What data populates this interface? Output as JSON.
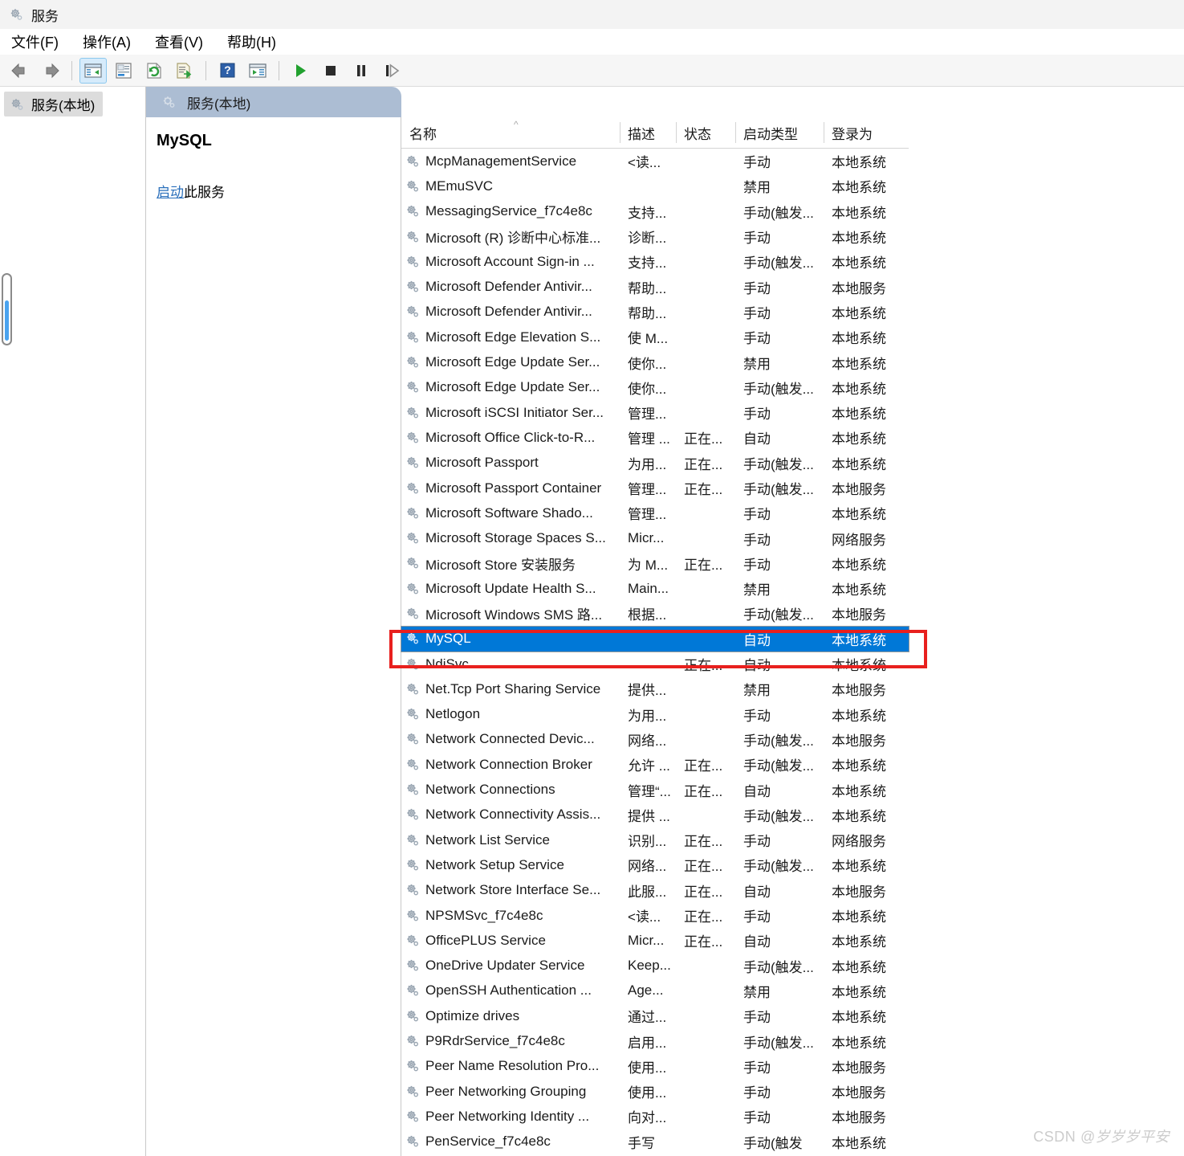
{
  "window": {
    "title": "服务",
    "title_icon": "gear-icon"
  },
  "menu": {
    "items": [
      {
        "label": "文件(F)",
        "name": "file"
      },
      {
        "label": "操作(A)",
        "name": "action"
      },
      {
        "label": "查看(V)",
        "name": "view"
      },
      {
        "label": "帮助(H)",
        "name": "help"
      }
    ]
  },
  "toolbar": {
    "buttons": [
      {
        "name": "back-icon",
        "glyph": "back"
      },
      {
        "name": "forward-icon",
        "glyph": "forward"
      },
      {
        "name": "show-hide-tree-icon",
        "glyph": "tree"
      },
      {
        "name": "properties-icon",
        "glyph": "properties"
      },
      {
        "name": "refresh-icon",
        "glyph": "refresh"
      },
      {
        "name": "export-list-icon",
        "glyph": "export"
      },
      {
        "name": "help-icon",
        "glyph": "help"
      },
      {
        "name": "show-action-pane-icon",
        "glyph": "actionpane"
      },
      {
        "name": "start-service-icon",
        "glyph": "play"
      },
      {
        "name": "stop-service-icon",
        "glyph": "stop"
      },
      {
        "name": "pause-service-icon",
        "glyph": "pause"
      },
      {
        "name": "restart-service-icon",
        "glyph": "restart"
      }
    ]
  },
  "tree": {
    "items": [
      {
        "label": "服务(本地)",
        "icon": "gear-icon",
        "selected": true
      }
    ]
  },
  "panel": {
    "header": "服务(本地)",
    "header_icon": "gear-icon"
  },
  "detail": {
    "service_name": "MySQL",
    "action_link": "启动",
    "action_suffix": "此服务"
  },
  "grid": {
    "sort_indicator": "^",
    "sort_column": "名称",
    "columns": [
      {
        "key": "name",
        "label": "名称"
      },
      {
        "key": "desc",
        "label": "描述"
      },
      {
        "key": "status",
        "label": "状态"
      },
      {
        "key": "start",
        "label": "启动类型"
      },
      {
        "key": "logon",
        "label": "登录为"
      }
    ],
    "rows": [
      {
        "name": "McpManagementService",
        "desc": "<读...",
        "status": "",
        "start": "手动",
        "logon": "本地系统",
        "selected": false
      },
      {
        "name": "MEmuSVC",
        "desc": "",
        "status": "",
        "start": "禁用",
        "logon": "本地系统",
        "selected": false
      },
      {
        "name": "MessagingService_f7c4e8c",
        "desc": "支持...",
        "status": "",
        "start": "手动(触发...",
        "logon": "本地系统",
        "selected": false
      },
      {
        "name": "Microsoft (R) 诊断中心标准...",
        "desc": "诊断...",
        "status": "",
        "start": "手动",
        "logon": "本地系统",
        "selected": false
      },
      {
        "name": "Microsoft Account Sign-in ...",
        "desc": "支持...",
        "status": "",
        "start": "手动(触发...",
        "logon": "本地系统",
        "selected": false
      },
      {
        "name": "Microsoft Defender Antivir...",
        "desc": "帮助...",
        "status": "",
        "start": "手动",
        "logon": "本地服务",
        "selected": false
      },
      {
        "name": "Microsoft Defender Antivir...",
        "desc": "帮助...",
        "status": "",
        "start": "手动",
        "logon": "本地系统",
        "selected": false
      },
      {
        "name": "Microsoft Edge Elevation S...",
        "desc": "使 M...",
        "status": "",
        "start": "手动",
        "logon": "本地系统",
        "selected": false
      },
      {
        "name": "Microsoft Edge Update Ser...",
        "desc": "使你...",
        "status": "",
        "start": "禁用",
        "logon": "本地系统",
        "selected": false
      },
      {
        "name": "Microsoft Edge Update Ser...",
        "desc": "使你...",
        "status": "",
        "start": "手动(触发...",
        "logon": "本地系统",
        "selected": false
      },
      {
        "name": "Microsoft iSCSI Initiator Ser...",
        "desc": "管理...",
        "status": "",
        "start": "手动",
        "logon": "本地系统",
        "selected": false
      },
      {
        "name": "Microsoft Office Click-to-R...",
        "desc": "管理 ...",
        "status": "正在...",
        "start": "自动",
        "logon": "本地系统",
        "selected": false
      },
      {
        "name": "Microsoft Passport",
        "desc": "为用...",
        "status": "正在...",
        "start": "手动(触发...",
        "logon": "本地系统",
        "selected": false
      },
      {
        "name": "Microsoft Passport Container",
        "desc": "管理...",
        "status": "正在...",
        "start": "手动(触发...",
        "logon": "本地服务",
        "selected": false
      },
      {
        "name": "Microsoft Software Shado...",
        "desc": "管理...",
        "status": "",
        "start": "手动",
        "logon": "本地系统",
        "selected": false
      },
      {
        "name": "Microsoft Storage Spaces S...",
        "desc": "Micr...",
        "status": "",
        "start": "手动",
        "logon": "网络服务",
        "selected": false
      },
      {
        "name": "Microsoft Store 安装服务",
        "desc": "为 M...",
        "status": "正在...",
        "start": "手动",
        "logon": "本地系统",
        "selected": false
      },
      {
        "name": "Microsoft Update Health S...",
        "desc": "Main...",
        "status": "",
        "start": "禁用",
        "logon": "本地系统",
        "selected": false
      },
      {
        "name": "Microsoft Windows SMS 路...",
        "desc": "根据...",
        "status": "",
        "start": "手动(触发...",
        "logon": "本地服务",
        "selected": false
      },
      {
        "name": "MySQL",
        "desc": "",
        "status": "",
        "start": "自动",
        "logon": "本地系统",
        "selected": true
      },
      {
        "name": "NdiSvc",
        "desc": "",
        "status": "正在...",
        "start": "自动",
        "logon": "本地系统",
        "selected": false
      },
      {
        "name": "Net.Tcp Port Sharing Service",
        "desc": "提供...",
        "status": "",
        "start": "禁用",
        "logon": "本地服务",
        "selected": false
      },
      {
        "name": "Netlogon",
        "desc": "为用...",
        "status": "",
        "start": "手动",
        "logon": "本地系统",
        "selected": false
      },
      {
        "name": "Network Connected Devic...",
        "desc": "网络...",
        "status": "",
        "start": "手动(触发...",
        "logon": "本地服务",
        "selected": false
      },
      {
        "name": "Network Connection Broker",
        "desc": "允许 ...",
        "status": "正在...",
        "start": "手动(触发...",
        "logon": "本地系统",
        "selected": false
      },
      {
        "name": "Network Connections",
        "desc": "管理“...",
        "status": "正在...",
        "start": "自动",
        "logon": "本地系统",
        "selected": false
      },
      {
        "name": "Network Connectivity Assis...",
        "desc": "提供 ...",
        "status": "",
        "start": "手动(触发...",
        "logon": "本地系统",
        "selected": false
      },
      {
        "name": "Network List Service",
        "desc": "识别...",
        "status": "正在...",
        "start": "手动",
        "logon": "网络服务",
        "selected": false
      },
      {
        "name": "Network Setup Service",
        "desc": "网络...",
        "status": "正在...",
        "start": "手动(触发...",
        "logon": "本地系统",
        "selected": false
      },
      {
        "name": "Network Store Interface Se...",
        "desc": "此服...",
        "status": "正在...",
        "start": "自动",
        "logon": "本地服务",
        "selected": false
      },
      {
        "name": "NPSMSvc_f7c4e8c",
        "desc": "<读...",
        "status": "正在...",
        "start": "手动",
        "logon": "本地系统",
        "selected": false
      },
      {
        "name": "OfficePLUS Service",
        "desc": "Micr...",
        "status": "正在...",
        "start": "自动",
        "logon": "本地系统",
        "selected": false
      },
      {
        "name": "OneDrive Updater Service",
        "desc": "Keep...",
        "status": "",
        "start": "手动(触发...",
        "logon": "本地系统",
        "selected": false
      },
      {
        "name": "OpenSSH Authentication ...",
        "desc": "Age...",
        "status": "",
        "start": "禁用",
        "logon": "本地系统",
        "selected": false
      },
      {
        "name": "Optimize drives",
        "desc": "通过...",
        "status": "",
        "start": "手动",
        "logon": "本地系统",
        "selected": false
      },
      {
        "name": "P9RdrService_f7c4e8c",
        "desc": "启用...",
        "status": "",
        "start": "手动(触发...",
        "logon": "本地系统",
        "selected": false
      },
      {
        "name": "Peer Name Resolution Pro...",
        "desc": "使用...",
        "status": "",
        "start": "手动",
        "logon": "本地服务",
        "selected": false
      },
      {
        "name": "Peer Networking Grouping",
        "desc": "使用...",
        "status": "",
        "start": "手动",
        "logon": "本地服务",
        "selected": false
      },
      {
        "name": "Peer Networking Identity ...",
        "desc": "向对...",
        "status": "",
        "start": "手动",
        "logon": "本地服务",
        "selected": false
      },
      {
        "name": "PenService_f7c4e8c",
        "desc": "手写",
        "status": "",
        "start": "手动(触发",
        "logon": "本地系统",
        "selected": false
      }
    ]
  },
  "annotation": {
    "highlight_target": "MySQL",
    "color": "#e8201e"
  },
  "watermark": {
    "prefix": "CSDN ",
    "handle": "@岁岁岁平安"
  },
  "colors": {
    "selection": "#0078d7",
    "panel_header": "#acbdd3",
    "link": "#2a6fbb",
    "annotation": "#e8201e"
  }
}
